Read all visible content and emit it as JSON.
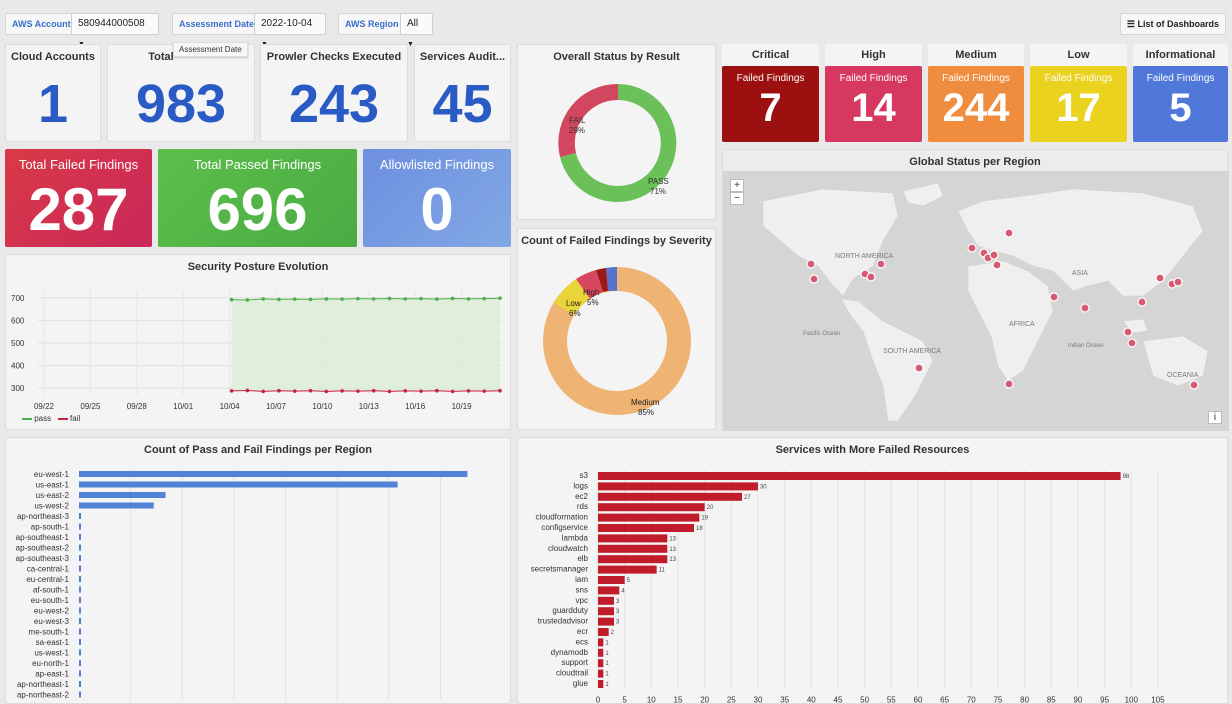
{
  "filters": {
    "account_label": "AWS Account",
    "account_value": "580944000508",
    "date_label": "Assessment Date",
    "date_value": "2022-10-04",
    "region_label": "AWS Region",
    "region_value": "All",
    "tooltip": "Assessment Date",
    "dashboards_label": "List of Dashboards"
  },
  "stats": {
    "cloud_accounts": {
      "title": "Cloud Accounts",
      "value": "1"
    },
    "total": {
      "title": "Total",
      "value": "983"
    },
    "checks": {
      "title": "Prowler Checks Executed",
      "value": "243"
    },
    "services": {
      "title": "Services Audit...",
      "value": "45"
    }
  },
  "findings": {
    "failed": {
      "title": "Total Failed Findings",
      "value": "287",
      "color": "#d42f4f"
    },
    "passed": {
      "title": "Total Passed Findings",
      "value": "696",
      "color": "#55b648"
    },
    "allowlisted": {
      "title": "Allowlisted Findings",
      "value": "0",
      "color": "#7699e0"
    }
  },
  "overall_status": {
    "title": "Overall Status by Result",
    "fail_label": "FAIL",
    "fail_pct": "29%",
    "pass_label": "PASS",
    "pass_pct": "71%"
  },
  "severity_donut": {
    "title": "Count of Failed Findings by Severity",
    "high_label": "High",
    "high_pct": "5%",
    "low_label": "Low",
    "low_pct": "6%",
    "medium_label": "Medium",
    "medium_pct": "85%"
  },
  "severity": [
    {
      "name": "Critical",
      "label": "Failed Findings",
      "value": "7",
      "color": "#9c1010"
    },
    {
      "name": "High",
      "label": "Failed Findings",
      "value": "14",
      "color": "#d6385f"
    },
    {
      "name": "Medium",
      "label": "Failed Findings",
      "value": "244",
      "color": "#f08c3e"
    },
    {
      "name": "Low",
      "label": "Failed Findings",
      "value": "17",
      "color": "#ead21f"
    },
    {
      "name": "Informational",
      "label": "Failed Findings",
      "value": "5",
      "color": "#4f78d8"
    }
  ],
  "map": {
    "title": "Global Status per Region",
    "zoom_in": "+",
    "zoom_out": "−",
    "info": "i",
    "labels": [
      "NORTH AMERICA",
      "ASIA",
      "AFRICA",
      "SOUTH AMERICA",
      "OCEANIA",
      "Pacific Ocean",
      "Indian Ocean"
    ]
  },
  "posture": {
    "title": "Security Posture Evolution",
    "legend_pass": "pass",
    "legend_fail": "fail"
  },
  "region_chart_title": "Count of Pass and Fail Findings per Region",
  "services_chart_title": "Services with More Failed Resources",
  "chart_data": [
    {
      "type": "line",
      "title": "Security Posture Evolution",
      "x": [
        "10/04",
        "10/05",
        "10/06",
        "10/07",
        "10/08",
        "10/09",
        "10/10",
        "10/11",
        "10/12",
        "10/13",
        "10/14",
        "10/15",
        "10/16",
        "10/17",
        "10/18",
        "10/19",
        "10/20",
        "10/21"
      ],
      "x_ticks": [
        "09/22",
        "09/25",
        "09/28",
        "10/01",
        "10/04",
        "10/07",
        "10/10",
        "10/13",
        "10/16",
        "10/19"
      ],
      "y_ticks": [
        300,
        400,
        500,
        600,
        700
      ],
      "ylim": [
        270,
        730
      ],
      "series": [
        {
          "name": "pass",
          "color": "#4cae4c",
          "values": [
            692,
            690,
            695,
            693,
            694,
            693,
            695,
            694,
            696,
            695,
            697,
            695,
            696,
            694,
            697,
            695,
            696,
            698
          ]
        },
        {
          "name": "fail",
          "color": "#c8233e",
          "values": [
            288,
            290,
            286,
            289,
            287,
            289,
            286,
            288,
            287,
            289,
            286,
            288,
            287,
            289,
            286,
            288,
            287,
            289
          ]
        }
      ]
    },
    {
      "type": "bar",
      "title": "Count of Pass and Fail Findings per Region",
      "categories": [
        "eu-west-1",
        "us-east-1",
        "us-east-2",
        "us-west-2",
        "ap-northeast-3",
        "ap-south-1",
        "ap-southeast-1",
        "ap-southeast-2",
        "ap-southeast-3",
        "ca-central-1",
        "eu-central-1",
        "af-south-1",
        "eu-south-1",
        "eu-west-2",
        "eu-west-3",
        "me-south-1",
        "sa-east-1",
        "us-west-1",
        "eu-north-1",
        "ap-east-1",
        "ap-northeast-1",
        "ap-northeast-2"
      ],
      "values": [
        395,
        324,
        88,
        76,
        2,
        2,
        2,
        2,
        2,
        2,
        2,
        2,
        2,
        2,
        2,
        2,
        2,
        2,
        2,
        2,
        2,
        2
      ],
      "xlim": [
        0,
        420
      ]
    },
    {
      "type": "bar",
      "title": "Services with More Failed Resources",
      "categories": [
        "s3",
        "logs",
        "ec2",
        "rds",
        "cloudformation",
        "configservice",
        "lambda",
        "cloudwatch",
        "elb",
        "secretsmanager",
        "iam",
        "sns",
        "vpc",
        "guardduty",
        "trustedadvisor",
        "ecr",
        "ecs",
        "dynamodb",
        "support",
        "cloudtrail",
        "glue"
      ],
      "values": [
        98,
        30,
        27,
        20,
        19,
        18,
        13,
        13,
        13,
        11,
        5,
        4,
        3,
        3,
        3,
        2,
        1,
        1,
        1,
        1,
        1
      ],
      "x_ticks": [
        0,
        5,
        10,
        15,
        20,
        25,
        30,
        35,
        40,
        45,
        50,
        55,
        60,
        65,
        70,
        75,
        80,
        85,
        90,
        95,
        100,
        105
      ],
      "xlim": [
        0,
        108
      ],
      "color": "#c01c2c"
    }
  ]
}
